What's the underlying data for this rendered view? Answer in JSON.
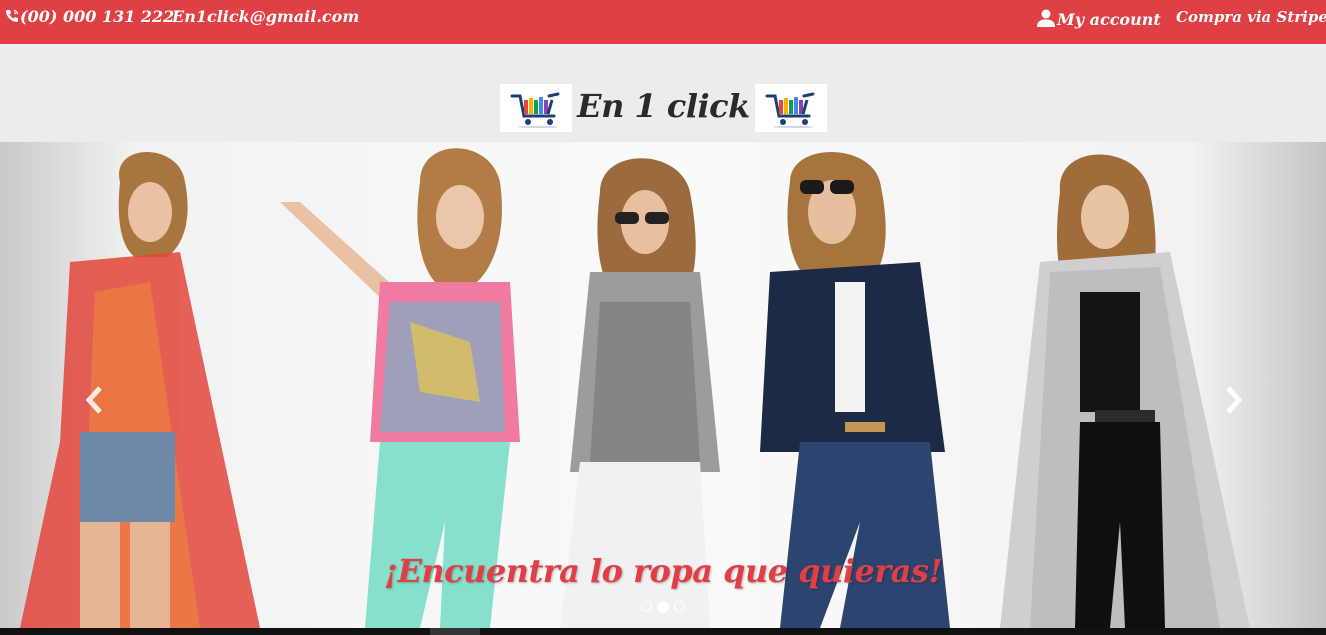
{
  "topbar": {
    "phone": "(00) 000 131 222",
    "email": "En1click@gmail.com",
    "account": "My account",
    "stripe": "Compra via Stripe!",
    "background_color": "#de4045"
  },
  "brand": {
    "title": "En 1 click"
  },
  "carousel": {
    "caption": "¡Encuentra lo ropa que quieras!",
    "caption_color": "#e04045",
    "active_slide": 2,
    "slide_count": 3,
    "prev_icon": "chevron-left-icon",
    "next_icon": "chevron-right-icon"
  }
}
